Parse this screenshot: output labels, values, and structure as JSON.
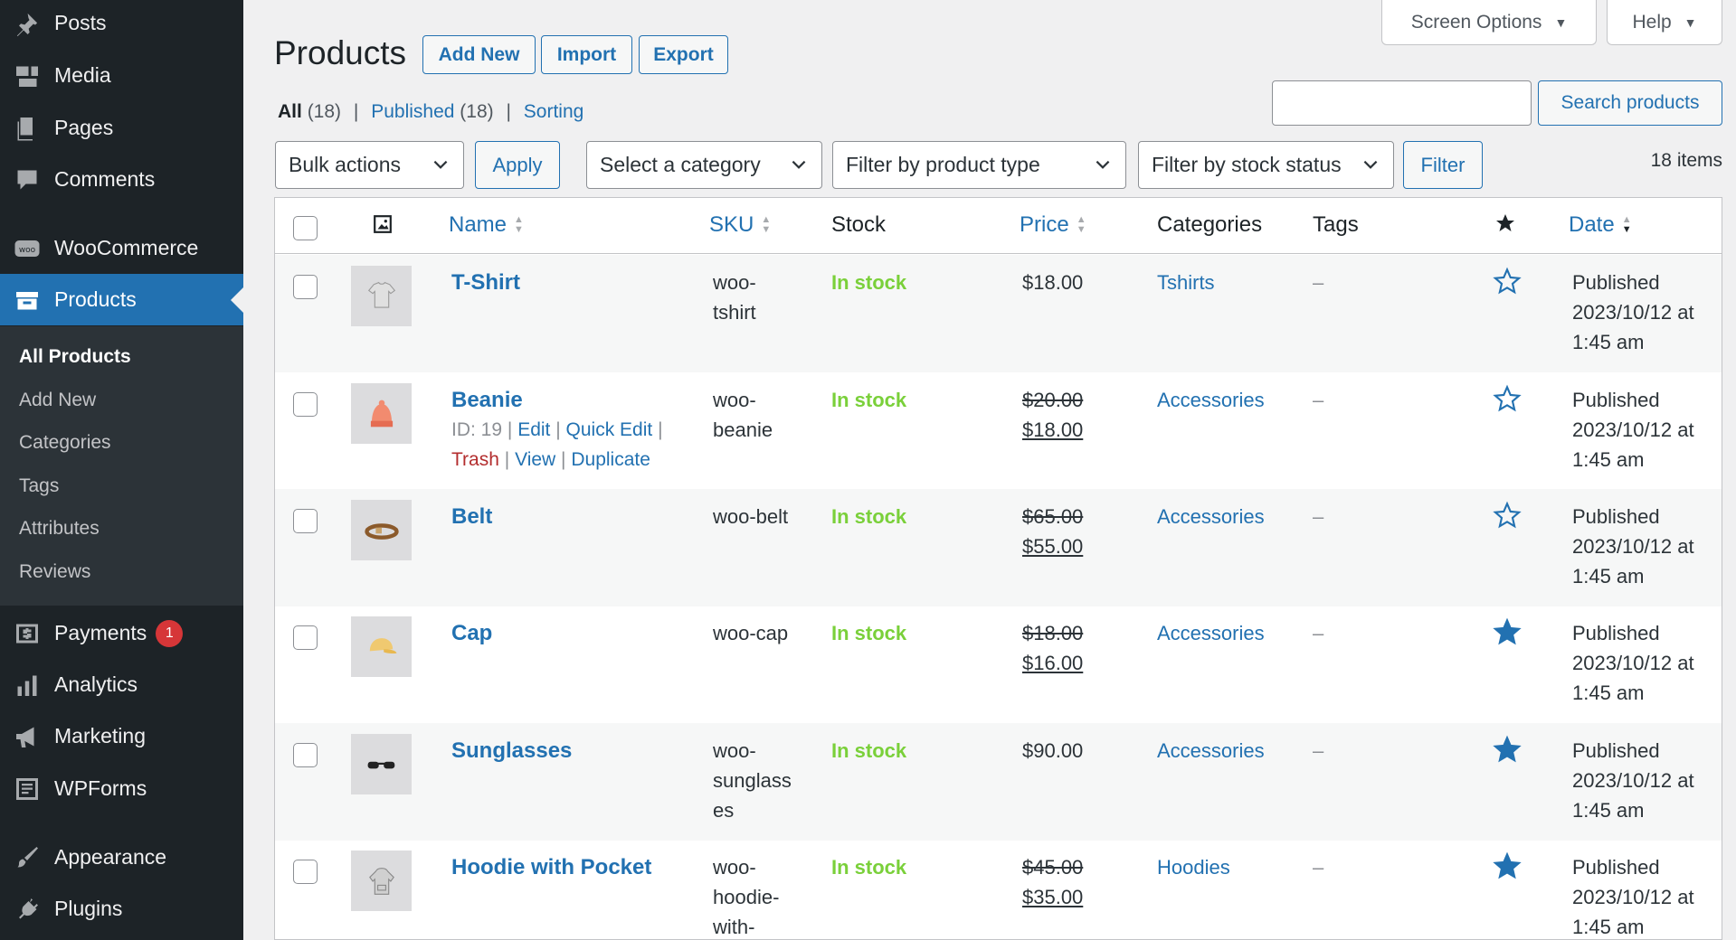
{
  "sidebar": {
    "items": [
      {
        "label": "Posts",
        "icon": "pin-icon"
      },
      {
        "label": "Media",
        "icon": "media-icon"
      },
      {
        "label": "Pages",
        "icon": "pages-icon"
      },
      {
        "label": "Comments",
        "icon": "comments-icon"
      },
      {
        "label": "WooCommerce",
        "icon": "woo-icon"
      },
      {
        "label": "Products",
        "icon": "products-icon",
        "current": true
      },
      {
        "label": "Payments",
        "icon": "payments-icon",
        "badge": "1"
      },
      {
        "label": "Analytics",
        "icon": "analytics-icon"
      },
      {
        "label": "Marketing",
        "icon": "marketing-icon"
      },
      {
        "label": "WPForms",
        "icon": "wpforms-icon"
      },
      {
        "label": "Appearance",
        "icon": "appearance-icon"
      },
      {
        "label": "Plugins",
        "icon": "plugins-icon"
      }
    ],
    "submenu": [
      "All Products",
      "Add New",
      "Categories",
      "Tags",
      "Attributes",
      "Reviews"
    ]
  },
  "topbar": {
    "screen_options": "Screen Options",
    "help": "Help"
  },
  "header": {
    "title": "Products",
    "add_new": "Add New",
    "import": "Import",
    "export": "Export"
  },
  "views": {
    "all": "All",
    "all_count": "(18)",
    "published": "Published",
    "published_count": "(18)",
    "sorting": "Sorting",
    "separator": "|"
  },
  "search": {
    "value": "",
    "button": "Search products"
  },
  "filters": {
    "bulk_actions": "Bulk actions",
    "apply": "Apply",
    "category": "Select a category",
    "product_type": "Filter by product type",
    "stock_status": "Filter by stock status",
    "filter": "Filter",
    "items_count": "18 items"
  },
  "table": {
    "columns": {
      "name": "Name",
      "sku": "SKU",
      "stock": "Stock",
      "price": "Price",
      "categories": "Categories",
      "tags": "Tags",
      "date": "Date"
    },
    "rows": [
      {
        "name": "T-Shirt",
        "sku": [
          "woo-",
          "tshirt"
        ],
        "stock": "In stock",
        "price": "$18.00",
        "category": "Tshirts",
        "tags": "–",
        "featured": false,
        "date": [
          "Published",
          "2023/10/12 at",
          "1:45 am"
        ],
        "thumb": "tshirt-thumbnail"
      },
      {
        "name": "Beanie",
        "sku": [
          "woo-",
          "beanie"
        ],
        "stock": "In stock",
        "price_old": "$20.00",
        "price": "$18.00",
        "category": "Accessories",
        "tags": "–",
        "featured": false,
        "date": [
          "Published",
          "2023/10/12 at",
          "1:45 am"
        ],
        "thumb": "beanie-thumbnail",
        "actions": {
          "id": "ID: 19",
          "edit": "Edit",
          "quick_edit": "Quick Edit",
          "trash": "Trash",
          "view": "View",
          "duplicate": "Duplicate",
          "sep": "|"
        }
      },
      {
        "name": "Belt",
        "sku": [
          "woo-belt"
        ],
        "stock": "In stock",
        "price_old": "$65.00",
        "price": "$55.00",
        "category": "Accessories",
        "tags": "–",
        "featured": false,
        "date": [
          "Published",
          "2023/10/12 at",
          "1:45 am"
        ],
        "thumb": "belt-thumbnail"
      },
      {
        "name": "Cap",
        "sku": [
          "woo-cap"
        ],
        "stock": "In stock",
        "price_old": "$18.00",
        "price": "$16.00",
        "category": "Accessories",
        "tags": "–",
        "featured": true,
        "date": [
          "Published",
          "2023/10/12 at",
          "1:45 am"
        ],
        "thumb": "cap-thumbnail"
      },
      {
        "name": "Sunglasses",
        "sku": [
          "woo-",
          "sunglass",
          "es"
        ],
        "stock": "In stock",
        "price": "$90.00",
        "category": "Accessories",
        "tags": "–",
        "featured": true,
        "date": [
          "Published",
          "2023/10/12 at",
          "1:45 am"
        ],
        "thumb": "sunglasses-thumbnail"
      },
      {
        "name": "Hoodie with Pocket",
        "sku": [
          "woo-",
          "hoodie-",
          "with-"
        ],
        "stock": "In stock",
        "price_old": "$45.00",
        "price": "$35.00",
        "category": "Hoodies",
        "tags": "–",
        "featured": true,
        "date": [
          "Published",
          "2023/10/12 at",
          "1:45 am"
        ],
        "thumb": "hoodie-thumbnail"
      }
    ]
  },
  "colors": {
    "accent": "#2271b1",
    "sidebar": "#1d2327",
    "in_stock": "#7ad03a",
    "trash": "#b32d2e",
    "badge": "#d63638"
  }
}
